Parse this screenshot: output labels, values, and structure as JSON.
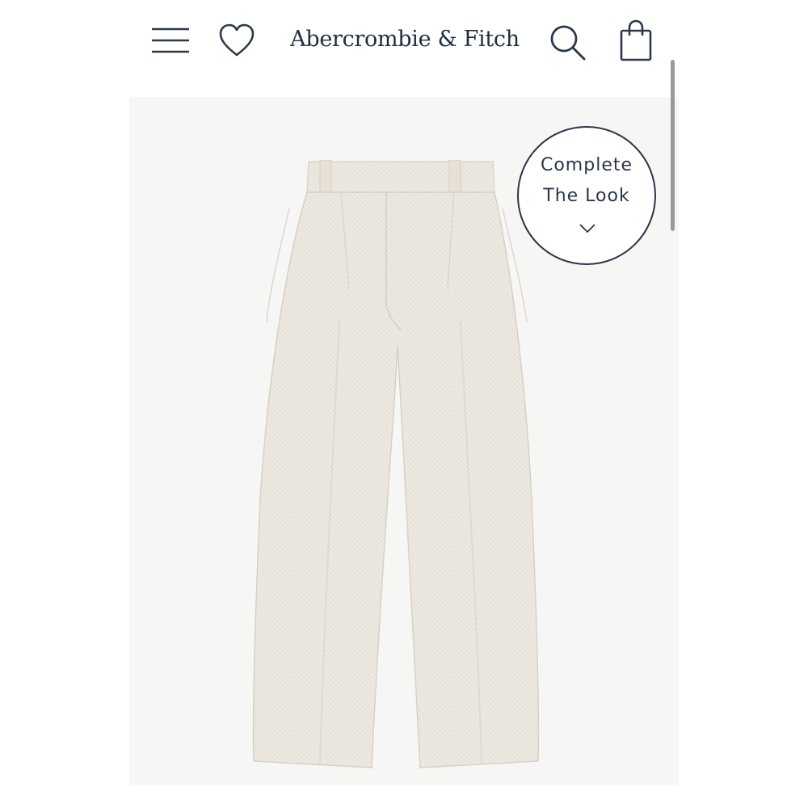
{
  "header": {
    "brand": "Abercrombie & Fitch",
    "icons": [
      "menu-icon",
      "heart-icon",
      "search-icon",
      "shopping-bag-icon"
    ]
  },
  "product": {
    "image": "wide-leg-linen-pants",
    "complete_the_look": {
      "line1": "Complete",
      "line2": "The Look",
      "icon": "chevron-down-icon"
    }
  },
  "colors": {
    "brand_text": "#1f2d3d",
    "badge_border": "#2a3648",
    "image_background": "#f6f6f5",
    "pants_fabric": "#ebe6de"
  }
}
